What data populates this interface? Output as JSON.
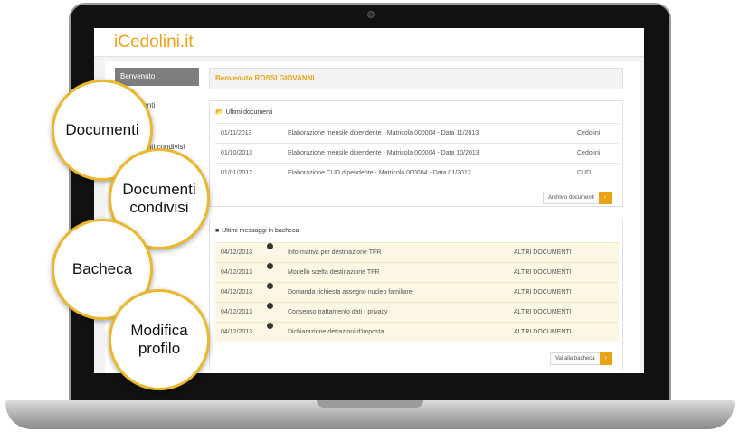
{
  "app": {
    "logo": "iCedolini.it",
    "accent_color": "#e8a317"
  },
  "sidebar": {
    "items": [
      {
        "label": "Benvenuto",
        "active": true
      },
      {
        "label": "Documenti"
      },
      {
        "label": "Documenti condivisi"
      }
    ]
  },
  "welcome": {
    "text": "Benvenuto ROSSI GIOVANNI"
  },
  "documents": {
    "icon": "folder-open-icon",
    "title": "Ultimi documenti",
    "rows": [
      {
        "date": "01/11/2013",
        "description": "Elaborazione mensile dipendente - Matricola 000004 - Data 11/2013",
        "type": "Cedolini"
      },
      {
        "date": "01/10/2013",
        "description": "Elaborazione mensile dipendente - Matricola 000004 - Data 10/2013",
        "type": "Cedolini"
      },
      {
        "date": "01/01/2012",
        "description": "Elaborazione CUD dipendente - Matricola 000004 - Data 01/2012",
        "type": "CUD"
      }
    ],
    "button": "Archivio documenti"
  },
  "board": {
    "icon": "comment-icon",
    "title": "Ultimi messaggi in bacheca",
    "rows": [
      {
        "date": "04/12/2013",
        "description": "Informativa per destinazione TFR",
        "category": "ALTRI DOCUMENTI"
      },
      {
        "date": "04/12/2013",
        "description": "Modello scelta destinazione TFR",
        "category": "ALTRI DOCUMENTI"
      },
      {
        "date": "04/12/2013",
        "description": "Domanda richiesta assegno nucleo familiare",
        "category": "ALTRI DOCUMENTI"
      },
      {
        "date": "04/12/2013",
        "description": "Consenso trattamento dati - privacy",
        "category": "ALTRI DOCUMENTI"
      },
      {
        "date": "04/12/2013",
        "description": "Dichiarazione detrazioni d'imposta",
        "category": "ALTRI DOCUMENTI"
      }
    ],
    "button": "Vai alla bacheca"
  },
  "callouts": [
    {
      "line1": "Documenti",
      "line2": ""
    },
    {
      "line1": "Documenti",
      "line2": "condivisi"
    },
    {
      "line1": "Bacheca",
      "line2": ""
    },
    {
      "line1": "Modifica",
      "line2": "profilo"
    }
  ]
}
